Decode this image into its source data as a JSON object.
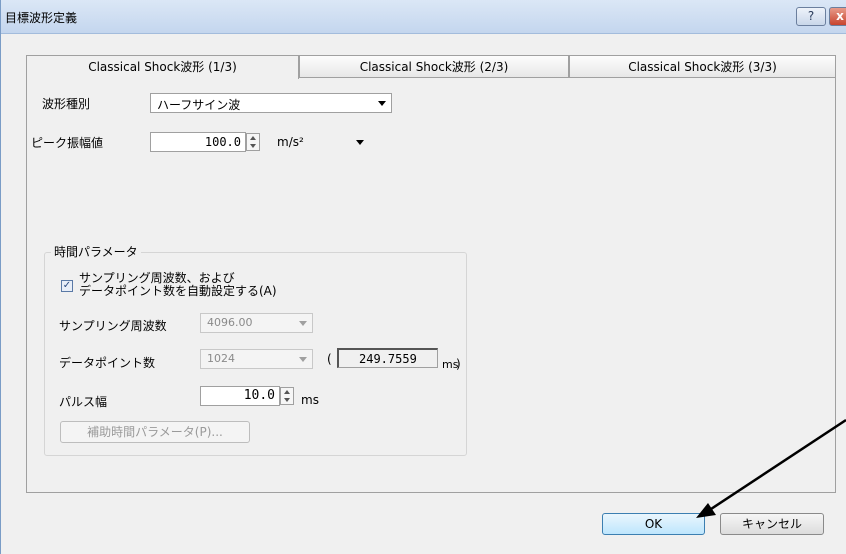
{
  "window": {
    "title": "目標波形定義",
    "help_label": "?",
    "close_label": "x"
  },
  "tabs": [
    {
      "label": "Classical Shock波形 (1/3)"
    },
    {
      "label": "Classical Shock波形 (2/3)"
    },
    {
      "label": "Classical Shock波形 (3/3)"
    }
  ],
  "waveform": {
    "label": "波形種別",
    "value": "ハーフサイン波"
  },
  "peak": {
    "label": "ピーク振幅値",
    "value": "100.0",
    "unit": "m/s²"
  },
  "time_params": {
    "group_title": "時間パラメータ",
    "auto_checkbox": {
      "line1": "サンプリング周波数、および",
      "line2": "データポイント数を自動設定する(A)",
      "checked": true
    },
    "sampling": {
      "label": "サンプリング周波数",
      "value": "4096.00"
    },
    "datapoints": {
      "label": "データポイント数",
      "value": "1024",
      "paren_open": "(",
      "duration": "249.7559",
      "duration_unit": "ms",
      "paren_close": ")"
    },
    "pulse": {
      "label": "パルス幅",
      "value": "10.0",
      "unit": "ms"
    },
    "aux_button": "補助時間パラメータ(P)..."
  },
  "footer": {
    "ok_label": "OK",
    "cancel_label": "キャンセル"
  }
}
